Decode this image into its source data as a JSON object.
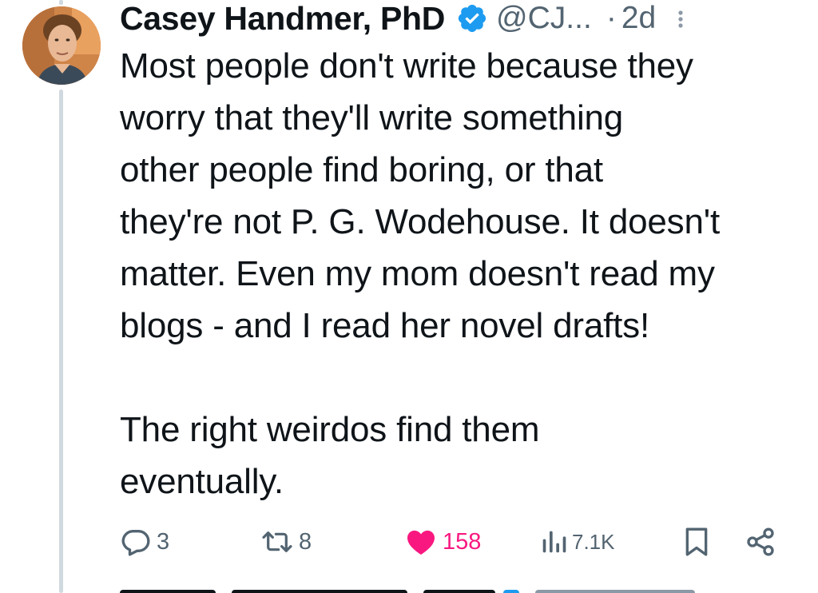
{
  "tweet": {
    "author": {
      "display_name": "Casey Handmer, PhD",
      "handle": "@CJ...",
      "verified": true,
      "avatar_icon": "profile-photo"
    },
    "separator": "·",
    "timestamp": "2d",
    "body_paragraphs": [
      [
        "Most people don't write because they",
        "worry that they'll write something",
        "other people find boring, or that",
        "they're not P. G. Wodehouse. It doesn't",
        "matter. Even my mom doesn't read my",
        "blogs - and I read her novel drafts!"
      ],
      [
        "The right weirdos find them",
        "eventually."
      ]
    ],
    "actions": {
      "reply": {
        "icon": "reply-icon",
        "count": "3"
      },
      "retweet": {
        "icon": "retweet-icon",
        "count": "8"
      },
      "like": {
        "icon": "heart-filled-icon",
        "count": "158",
        "liked": true
      },
      "views": {
        "icon": "views-icon",
        "count": "7.1K"
      },
      "bookmark": {
        "icon": "bookmark-icon"
      },
      "share": {
        "icon": "share-icon"
      }
    }
  },
  "colors": {
    "text_primary": "#0f1419",
    "text_secondary": "#536471",
    "verified_blue": "#1d9bf0",
    "like_pink": "#f91880",
    "thread_line": "#cfd9de"
  }
}
